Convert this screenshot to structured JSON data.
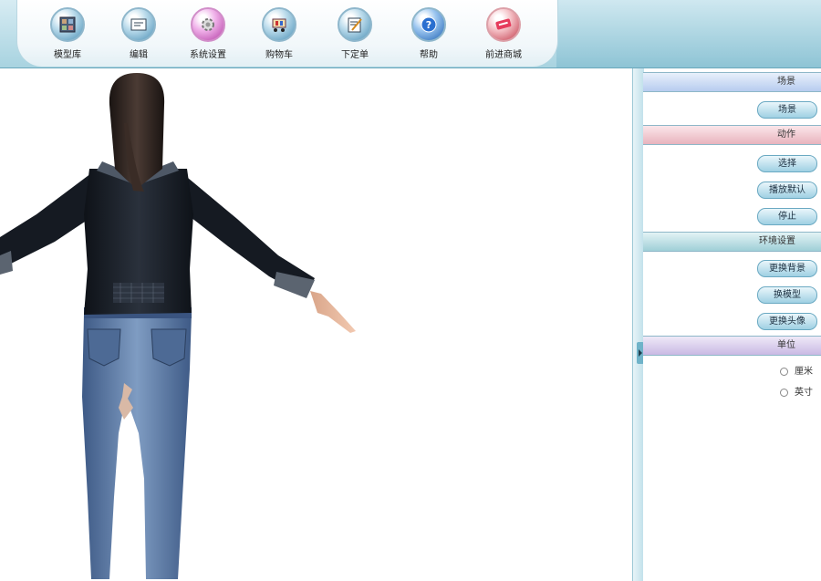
{
  "toolbar": {
    "items": [
      {
        "label": "模型库",
        "icon": "model-library-icon"
      },
      {
        "label": "编辑",
        "icon": "edit-icon"
      },
      {
        "label": "系统设置",
        "icon": "settings-icon"
      },
      {
        "label": "购物车",
        "icon": "cart-icon"
      },
      {
        "label": "下定单",
        "icon": "order-icon"
      },
      {
        "label": "帮助",
        "icon": "help-icon"
      },
      {
        "label": "前进商城",
        "icon": "mall-icon"
      }
    ]
  },
  "sidebar": {
    "scene": {
      "title": "场景",
      "buttons": [
        "场景"
      ]
    },
    "animation": {
      "title": "动作",
      "buttons": [
        "选择",
        "播放默认",
        "停止"
      ]
    },
    "environment": {
      "title": "环境设置",
      "buttons": [
        "更换背景",
        "换模型",
        "更换头像"
      ]
    },
    "units": {
      "title": "单位",
      "options": [
        "厘米",
        "英寸"
      ]
    }
  },
  "colors": {
    "toolbar_bg": "#a8d3e0",
    "button_fill": "#9fd0e3",
    "jeans": "#5f7ea8",
    "top": "#151a22"
  }
}
